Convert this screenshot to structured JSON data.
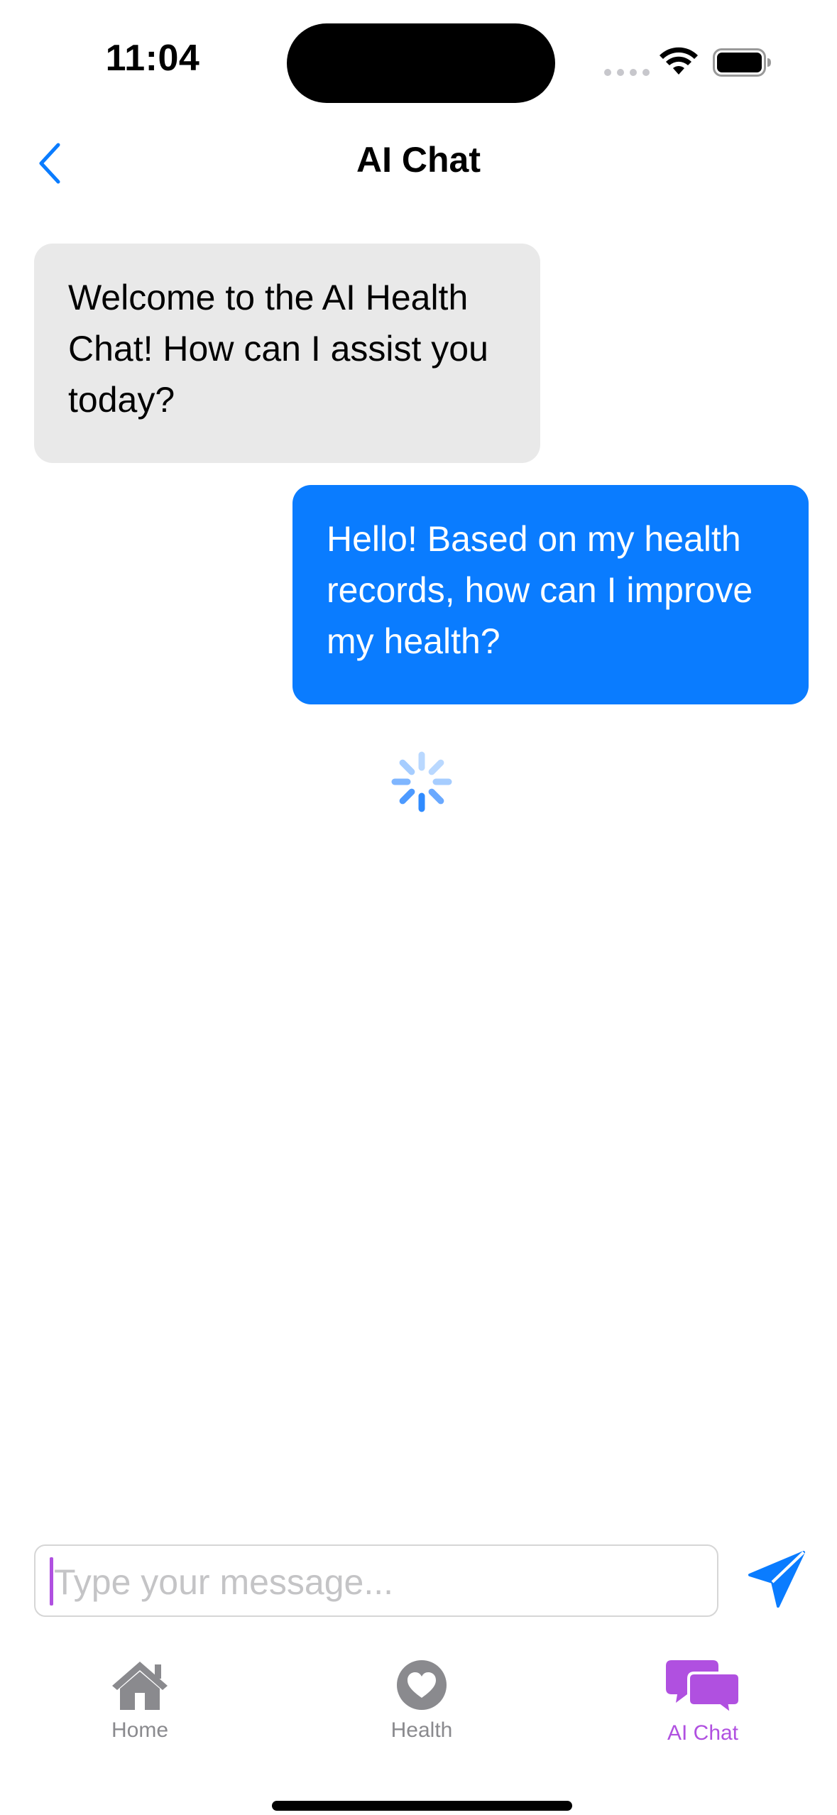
{
  "status_bar": {
    "time": "11:04"
  },
  "nav": {
    "back_icon": "chevron-left-icon",
    "title": "AI Chat"
  },
  "messages": [
    {
      "sender": "ai",
      "text": "Welcome to the AI Health Chat! How can I assist you today?"
    },
    {
      "sender": "user",
      "text": "Hello! Based on my health records, how can I improve my health?"
    }
  ],
  "loading": {
    "icon": "loading-spinner-icon"
  },
  "input": {
    "placeholder": "Type your message...",
    "value": "",
    "send_icon": "paper-plane-send-icon"
  },
  "tab_bar": {
    "tabs": [
      {
        "label": "Home",
        "icon": "house-icon",
        "selected": false
      },
      {
        "label": "Health",
        "icon": "heart-circle-icon",
        "selected": false
      },
      {
        "label": "AI Chat",
        "icon": "chat-bubbles-icon",
        "selected": true
      }
    ]
  },
  "colors": {
    "accent_blue": "#0a7cff",
    "ai_bubble": "#e9e9e9",
    "tab_selected": "#b050e0",
    "tab_unselected": "#8a8a8e"
  }
}
